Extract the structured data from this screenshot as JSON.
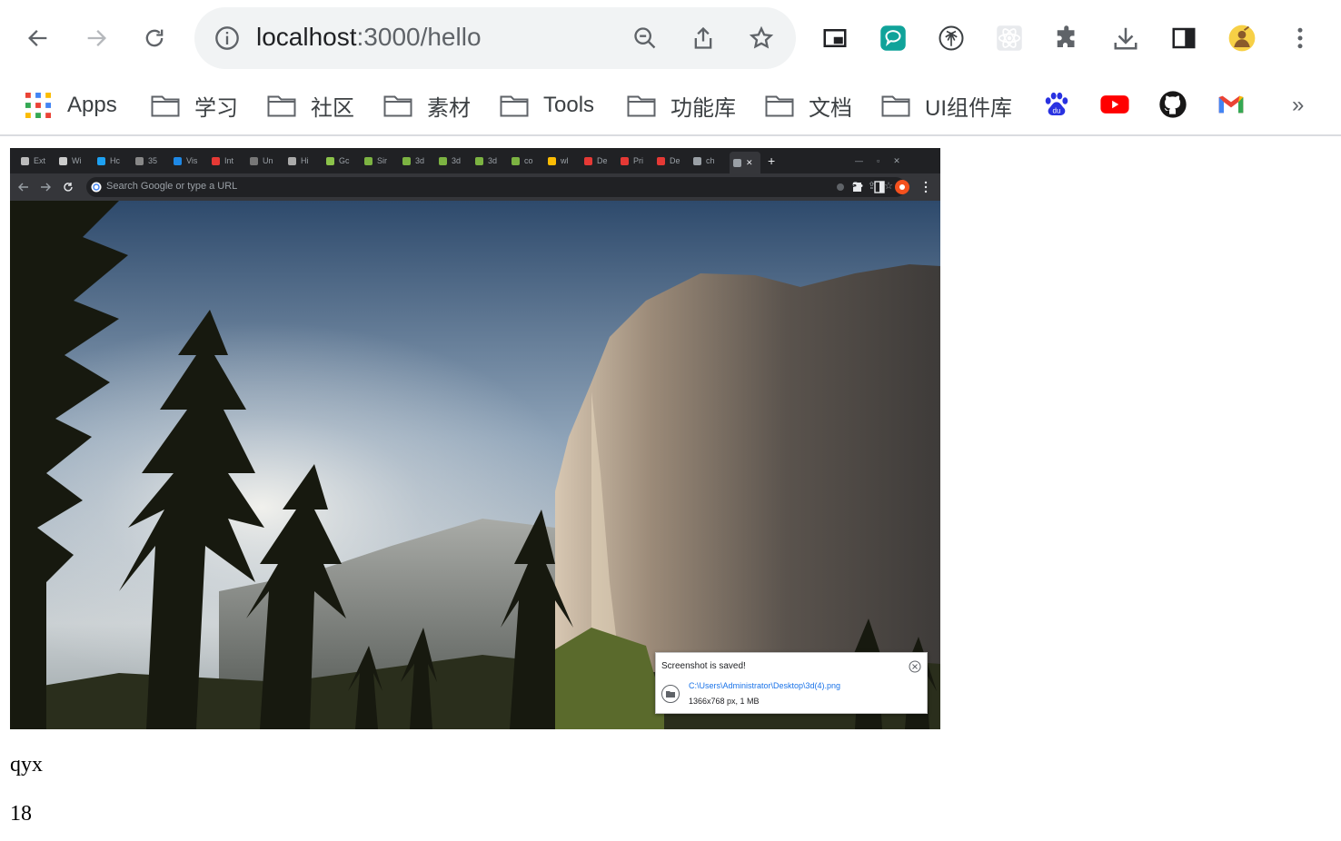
{
  "browser": {
    "url_host": "localhost",
    "url_path": ":3000/hello",
    "colors": {
      "omnibox_bg": "#f1f3f4",
      "icon_gray": "#5f6368"
    },
    "nav": {
      "back_icon": "arrow-left-icon",
      "forward_icon": "arrow-right-icon",
      "reload_icon": "reload-icon"
    },
    "omnibox_actions": [
      "zoom-icon",
      "share-icon",
      "star-icon"
    ],
    "extensions": [
      "picture-in-picture-icon",
      "chat-extension-icon",
      "palm-extension-icon",
      "react-devtools-icon",
      "puzzle-icon",
      "download-icon",
      "side-panel-icon",
      "avatar",
      "kebab-menu-icon"
    ]
  },
  "bookmarks": {
    "apps_label": "Apps",
    "folders": [
      "学习",
      "社区",
      "素材",
      "Tools",
      "功能库",
      "文档",
      "UI组件库"
    ],
    "sites": [
      "baidu-icon",
      "youtube-icon",
      "github-icon",
      "gmail-icon"
    ],
    "overflow": "»"
  },
  "screenshot": {
    "tabs": [
      "Ext",
      "Wi",
      "Hc",
      "35",
      "Vis",
      "Int",
      "Un",
      "Hi",
      "Gc",
      "Sir",
      "3d",
      "3d",
      "3d",
      "co",
      "wl",
      "De",
      "Pri",
      "De",
      "ch"
    ],
    "new_tab": "+",
    "address_placeholder": "Search Google or type a URL",
    "toast": {
      "title": "Screenshot is saved!",
      "path": "C:\\Users\\Administrator\\Desktop\\3d(4).png",
      "meta": "1366x768 px, 1 MB"
    }
  },
  "content": {
    "name": "qyx",
    "age": "18"
  }
}
